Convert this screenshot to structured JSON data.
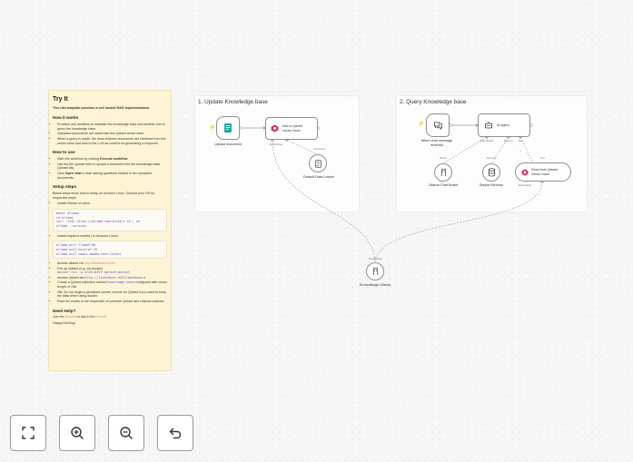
{
  "sticky": {
    "title": "Try It",
    "intro": "This n8n template provides a self hosted RAG implementation.",
    "how_title": "How it works",
    "how_items": [
      "Provides one workflow to maintain the knowledge base and another one to query the knowledge base.",
      "Uploaded documents are saved into the Qdrant vector store.",
      "When a query is made, the most relevant documents are retrieved from the vector store and sent to the LLM as context for generating a response."
    ],
    "use_title": "How to use",
    "use_items": [
      {
        "pre": "Start the workflow by clicking ",
        "bold": "Execute workflow",
        "post": ""
      },
      {
        "pre": "Use the file upload form to upload a document into the knowledge base (Qdrant db).",
        "bold": "",
        "post": ""
      },
      {
        "pre": "Click ",
        "bold": "Open chat",
        "post": " to start asking questions related to the uploaded documents."
      }
    ],
    "setup_title": "Setup steps",
    "setup_intro": "Below steps show how to setup on Amazon Linux. Consult your OS for respective steps",
    "install_ollama": "Install Ollama on prem",
    "code1": "mkdir ollama\ncd ollama\ncurl -fsSL https://ollama.com/install.sh | sh\nollama --version",
    "install_models": "Install required models ( in Amazon Linux)",
    "code2": "ollama pull llama3:8b\nollama pull mistral:7b\nollama pull nomic-embed-text:latest",
    "access_ollama_pre": "Access ollama via ",
    "access_ollama_link": "http://localhost:11434",
    "qdrant_fire": "Fire up Qdrant (e.g. via docker)",
    "qdrant_cmd": "docker run -p 6333:6333 qdrant/qdrant",
    "qdrant_access_pre": "Access Qdrant via ",
    "qdrant_access_link": "http://localhost:6333/dashboard",
    "collection_pre": "Create a Qdrant collection named ",
    "collection_name": "knowledge-base",
    "collection_post": " configured with vector length of 768.",
    "nb": "NB: Do not forget a persistent docker volume for Qdrant if you want to keep the data when using docker.",
    "point": "Point the nodes to the respective on premise Qdrant and Ollama runtimes.",
    "help_title": "Need Help?",
    "help_pre": "Join the ",
    "help_link1": "Discord",
    "help_mid": " or ask in the ",
    "help_link2": "Forum",
    "help_post": "!",
    "sign": "Happy RAGing!"
  },
  "groups": {
    "left_title": "1. Update Knowledge base",
    "right_title": "2. Query Knowledge base"
  },
  "nodes": {
    "upload": "Upload document",
    "qdrant_add": "Add to Qdrant\nVector Store",
    "data_loader": "Default Data Loader",
    "chat_trigger": "When chat message\nreceived",
    "ai_agent": "AI Agent",
    "chat_model": "Ollama Chat Model",
    "memory": "Simple Memory",
    "qdrant_read": "Read from Qdrant\nVector Store",
    "embeddings": "Embeddings Ollama"
  },
  "ports": {
    "embedding": "Embedding",
    "document": "Document",
    "chat_model": "Chat Model*",
    "memory": "Memory",
    "tool": "Tool",
    "model": "Model",
    "memory_small": "Memory",
    "tool_small": "Tool",
    "embedding_small": "Embedding",
    "embedding_bottom": "Embedding"
  },
  "controls": {
    "fit": "fit-view",
    "zoom_in": "zoom-in",
    "zoom_out": "zoom-out",
    "undo": "undo"
  }
}
